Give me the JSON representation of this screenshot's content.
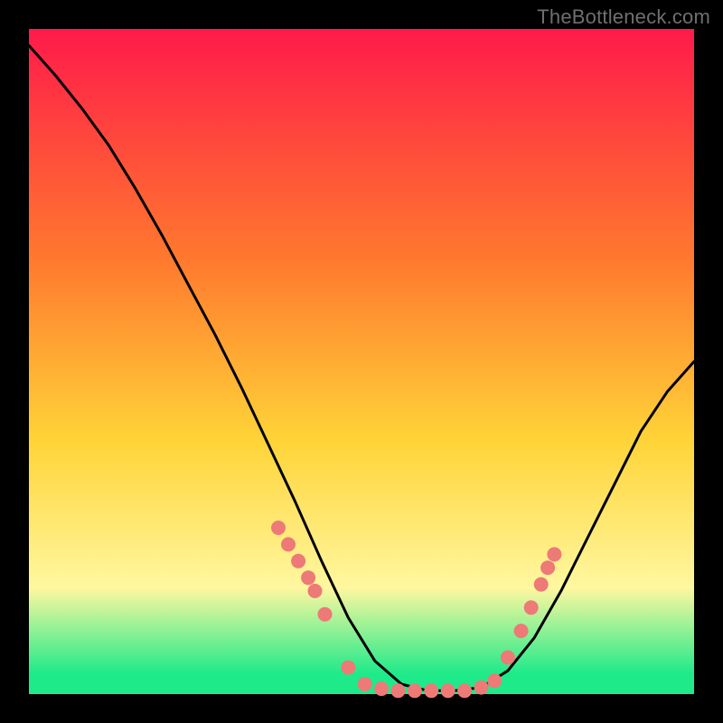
{
  "attribution": "TheBottleneck.com",
  "colors": {
    "background_black": "#000000",
    "grad_top": "#ff1a4a",
    "grad_mid1": "#ff7a2e",
    "grad_mid2": "#ffd438",
    "grad_yellow_pale": "#fff7a0",
    "grad_green": "#1eea8a",
    "curve": "#000000",
    "marker_fill": "#ed7a77",
    "marker_stroke": "#c55a57"
  },
  "chart_data": {
    "type": "line",
    "title": "",
    "xlabel": "",
    "ylabel": "",
    "xlim": [
      0,
      1
    ],
    "ylim": [
      0,
      1
    ],
    "x": [
      0.0,
      0.04,
      0.08,
      0.12,
      0.16,
      0.2,
      0.24,
      0.28,
      0.32,
      0.36,
      0.4,
      0.44,
      0.48,
      0.52,
      0.56,
      0.6,
      0.64,
      0.68,
      0.72,
      0.76,
      0.8,
      0.84,
      0.88,
      0.92,
      0.96,
      1.0
    ],
    "series": [
      {
        "name": "bottleneck_curve",
        "values": [
          0.975,
          0.93,
          0.88,
          0.825,
          0.76,
          0.69,
          0.615,
          0.54,
          0.46,
          0.375,
          0.29,
          0.2,
          0.115,
          0.05,
          0.015,
          0.005,
          0.005,
          0.01,
          0.035,
          0.085,
          0.155,
          0.235,
          0.315,
          0.395,
          0.455,
          0.5
        ]
      }
    ],
    "markers": [
      {
        "x": 0.375,
        "y": 0.25
      },
      {
        "x": 0.39,
        "y": 0.225
      },
      {
        "x": 0.405,
        "y": 0.2
      },
      {
        "x": 0.42,
        "y": 0.175
      },
      {
        "x": 0.43,
        "y": 0.155
      },
      {
        "x": 0.445,
        "y": 0.12
      },
      {
        "x": 0.48,
        "y": 0.04
      },
      {
        "x": 0.505,
        "y": 0.015
      },
      {
        "x": 0.53,
        "y": 0.008
      },
      {
        "x": 0.555,
        "y": 0.005
      },
      {
        "x": 0.58,
        "y": 0.005
      },
      {
        "x": 0.605,
        "y": 0.005
      },
      {
        "x": 0.63,
        "y": 0.005
      },
      {
        "x": 0.655,
        "y": 0.005
      },
      {
        "x": 0.68,
        "y": 0.01
      },
      {
        "x": 0.7,
        "y": 0.02
      },
      {
        "x": 0.72,
        "y": 0.055
      },
      {
        "x": 0.74,
        "y": 0.095
      },
      {
        "x": 0.755,
        "y": 0.13
      },
      {
        "x": 0.77,
        "y": 0.165
      },
      {
        "x": 0.78,
        "y": 0.19
      },
      {
        "x": 0.79,
        "y": 0.21
      }
    ]
  }
}
